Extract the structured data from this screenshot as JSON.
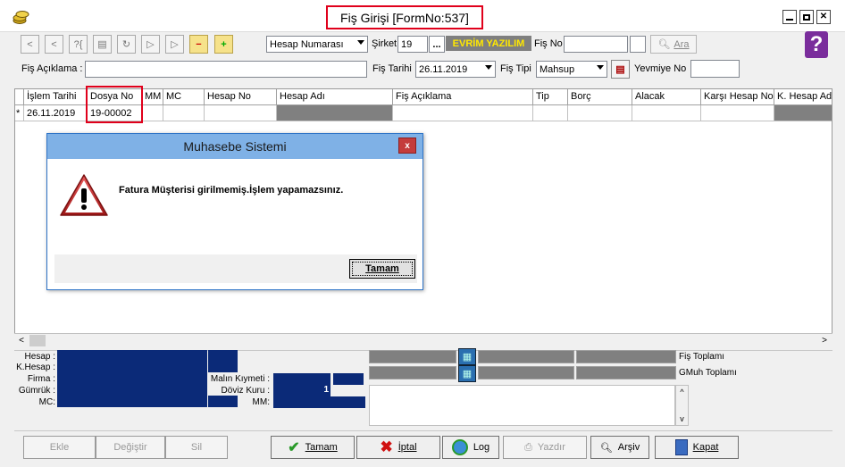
{
  "window": {
    "title": "Fiş Girişi [FormNo:537]",
    "controls": [
      "minimize",
      "maximize",
      "close"
    ]
  },
  "toolbar": {
    "account_type_select": "Hesap Numarası",
    "company_label": "Şirket",
    "company_code": "19",
    "company_browse": "...",
    "company_name": "EVRİM YAZILIM",
    "fis_no_label": "Fiş No",
    "fis_no_value": "",
    "search_label": "Ara",
    "help_icon": "?"
  },
  "form": {
    "aciklama_label": "Fiş Açıklama :",
    "aciklama_value": "",
    "tarih_label": "Fiş Tarihi",
    "tarih_value": "26.11.2019",
    "tipi_label": "Fiş  Tipi",
    "tipi_value": "Mahsup",
    "yevmiye_label": "Yevmiye No",
    "yevmiye_value": ""
  },
  "grid": {
    "columns": [
      "İşlem Tarihi",
      "Dosya No",
      "MM",
      "MC",
      "Hesap No",
      "Hesap Adı",
      "Fiş Açıklama",
      "Tip",
      "Borç",
      "Alacak",
      "Karşı Hesap No",
      "K. Hesap Adı"
    ],
    "rows": [
      {
        "marker": "*",
        "islem_tarihi": "26.11.2019",
        "dosya_no": "19-00002",
        "mm": "",
        "mc": "",
        "hesap_no": "",
        "hesap_adi": "",
        "aciklama": "",
        "tip": "",
        "borc": "",
        "alacak": "",
        "karsi_hesap_no": "",
        "k_hesap_adi": ""
      }
    ]
  },
  "dialog": {
    "title": "Muhasebe Sistemi",
    "close": "x",
    "message": "Fatura Müşterisi girilmemiş.İşlem yapamazsınız.",
    "ok_label": "Tamam"
  },
  "info": {
    "labels": [
      "Hesap :",
      "K.Hesap :",
      "Firma :",
      "Gümrük :",
      "MC:"
    ],
    "malin_kiymeti_label": "Malın Kıymeti :",
    "doviz_kuru_label": "Döviz Kuru :",
    "doviz_kuru_value": "1",
    "mm_label": "MM:",
    "fis_toplami": "Fiş Toplamı",
    "gmuh_toplami": "GMuh Toplamı"
  },
  "buttons": {
    "ekle": "Ekle",
    "degistir": "Değiştir",
    "sil": "Sil",
    "tamam": "Tamam",
    "iptal": "İptal",
    "log": "Log",
    "yazdir": "Yazdır",
    "arsiv": "Arşiv",
    "kapat": "Kapat"
  },
  "colors": {
    "highlight_red": "#e0001b",
    "navy_field": "#0b2a78",
    "company_name_text": "#ffe800",
    "dialog_title_bg": "#7fb1e6"
  }
}
